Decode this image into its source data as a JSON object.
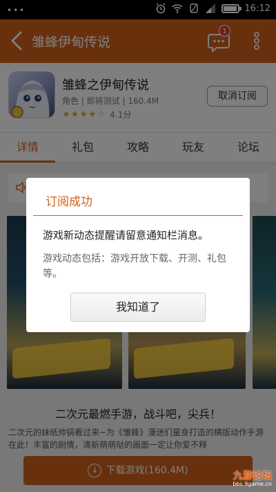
{
  "status_bar": {
    "time": "16:12",
    "dots": "•••",
    "icons": [
      "alarm-icon",
      "wifi-icon",
      "silent-icon",
      "signal-icon",
      "battery-icon"
    ]
  },
  "header": {
    "title": "雏蜂伊甸传说",
    "message_badge": "1"
  },
  "app": {
    "name": "雏蜂之伊甸传说",
    "meta": "角色 | 即将测试 | 160.4M",
    "rating": 4.1,
    "rating_text": "4.1分",
    "unsubscribe_label": "取消订阅"
  },
  "tabs": [
    {
      "label": "详情",
      "active": true
    },
    {
      "label": "礼包",
      "active": false
    },
    {
      "label": "攻略",
      "active": false
    },
    {
      "label": "玩友",
      "active": false
    },
    {
      "label": "论坛",
      "active": false
    }
  ],
  "content": {
    "game_title": "二次元最燃手游，战斗吧，尖兵！",
    "description": "二次元的妹纸帅锅看过来~为《雏蜂》漫迷们量身打造的横版动作手游在此！丰富的剧情，清新萌萌哒的画面一定让你爱不释",
    "download_label": "下载游戏(160.4M)"
  },
  "dialog": {
    "title": "订阅成功",
    "message": "游戏新动态提醒请留意通知栏消息。",
    "sub_message": "游戏动态包括：游戏开放下载、开测、礼包等。",
    "button_label": "我知道了"
  },
  "watermark": {
    "main": "九游论坛",
    "sub": "bbs.9game.cn"
  },
  "colors": {
    "accent": "#d2611a",
    "star": "#e8a33b",
    "badge": "#e53935"
  }
}
